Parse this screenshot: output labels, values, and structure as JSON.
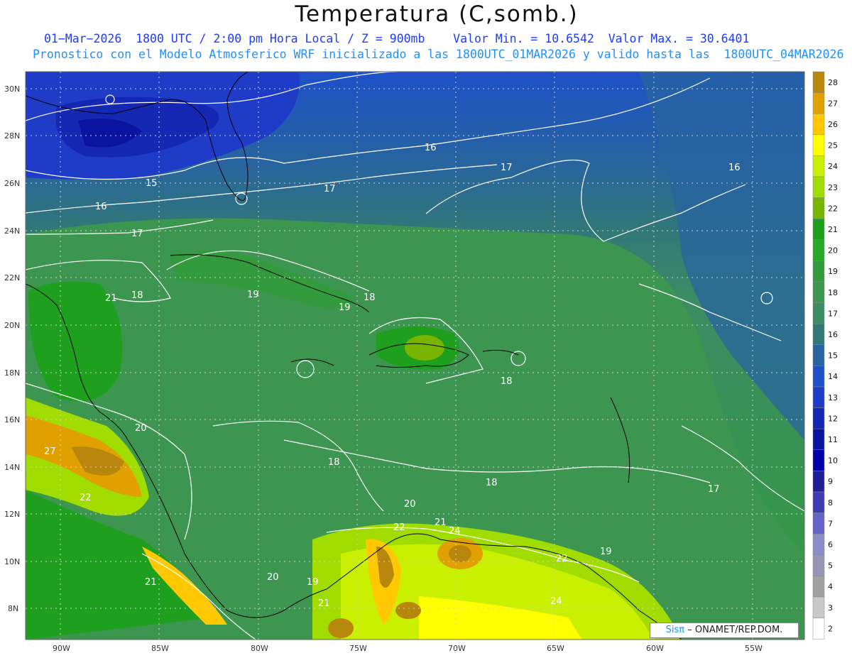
{
  "header": {
    "title": "Temperatura (C,somb.)",
    "line1": "01−Mar−2026  1800 UTC / 2:00 pm Hora Local / Z = 900mb    Valor Min. = 10.6542  Valor Max. = 30.6401",
    "line2": "Pronostico con el Modelo Atmosferico WRF inicializado a las 1800UTC_01MAR2026 y valido hasta las  1800UTC_04MAR2026"
  },
  "axes": {
    "lat_labels": [
      "30N",
      "28N",
      "26N",
      "24N",
      "22N",
      "20N",
      "18N",
      "16N",
      "14N",
      "12N",
      "10N",
      "8N"
    ],
    "lon_labels": [
      "90W",
      "85W",
      "80W",
      "75W",
      "70W",
      "65W",
      "60W",
      "55W"
    ]
  },
  "colorbar": {
    "labels": [
      "28",
      "27",
      "26",
      "25",
      "24",
      "23",
      "22",
      "21",
      "20",
      "19",
      "18",
      "17",
      "16",
      "15",
      "14",
      "13",
      "12",
      "11",
      "10",
      "9",
      "8",
      "7",
      "6",
      "5",
      "4",
      "3",
      "2"
    ],
    "colors": [
      "#b8860b",
      "#e0a000",
      "#ffc800",
      "#ffff00",
      "#c8f000",
      "#a0dc00",
      "#78b400",
      "#1ea01e",
      "#28a828",
      "#329b3c",
      "#3c9650",
      "#3c8c64",
      "#327878",
      "#2864a0",
      "#1e50c8",
      "#1e3cc8",
      "#1428b4",
      "#0a14a0",
      "#0000aa",
      "#1e1e96",
      "#3c3cb4",
      "#6464c8",
      "#8c8cc8",
      "#9696b4",
      "#a0a0a0",
      "#c8c8c8",
      "#ffffff"
    ]
  },
  "contour_labels": [
    {
      "text": "16"
    },
    {
      "text": "17"
    },
    {
      "text": "15"
    },
    {
      "text": "16"
    },
    {
      "text": "17"
    },
    {
      "text": "17"
    },
    {
      "text": "16"
    },
    {
      "text": "21"
    },
    {
      "text": "18"
    },
    {
      "text": "19"
    },
    {
      "text": "18"
    },
    {
      "text": "19"
    },
    {
      "text": "18"
    },
    {
      "text": "20"
    },
    {
      "text": "27"
    },
    {
      "text": "22"
    },
    {
      "text": "18"
    },
    {
      "text": "18"
    },
    {
      "text": "17"
    },
    {
      "text": "20"
    },
    {
      "text": "22"
    },
    {
      "text": "21"
    },
    {
      "text": "24"
    },
    {
      "text": "22"
    },
    {
      "text": "19"
    },
    {
      "text": "21"
    },
    {
      "text": "20"
    },
    {
      "text": "19"
    },
    {
      "text": "21"
    },
    {
      "text": "24"
    }
  ],
  "credit": {
    "brand": "Sisπ",
    "text": "– ONAMET/REP.DOM."
  }
}
